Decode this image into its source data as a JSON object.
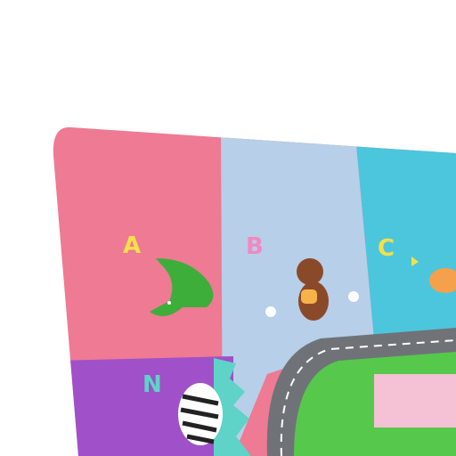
{
  "mat": {
    "letters": [
      {
        "char": "A",
        "animal": "crocodile",
        "color": "#f6e04a"
      },
      {
        "char": "B",
        "animal": "bear",
        "color": "#f08ac0"
      },
      {
        "char": "C",
        "animal": "cat",
        "color": "#f6e04a"
      },
      {
        "char": "N",
        "animal": "zebra",
        "color": "#5fd3c8"
      }
    ],
    "colors": {
      "pink": "#ee7a93",
      "light_blue": "#b7cfe8",
      "cyan": "#4cc6dc",
      "purple": "#a050c8",
      "road": "#6f7378",
      "grass": "#56c84c"
    }
  }
}
